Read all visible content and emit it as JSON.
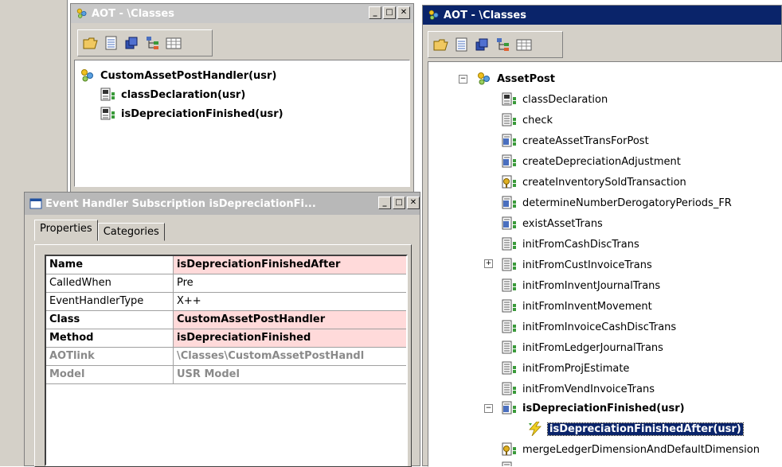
{
  "left_window": {
    "title": "AOT - \\Classes",
    "tree": [
      {
        "label": "CustomAssetPostHandler(usr)"
      },
      {
        "label": "classDeclaration(usr)"
      },
      {
        "label": "isDepreciationFinished(usr)"
      }
    ]
  },
  "event_dialog": {
    "title": "Event Handler Subscription isDepreciationFi...",
    "tabs": [
      {
        "label": "Properties"
      },
      {
        "label": "Categories"
      }
    ],
    "properties": [
      {
        "key": "Name",
        "value": "isDepreciationFinishedAfter"
      },
      {
        "key": "CalledWhen",
        "value": "Pre"
      },
      {
        "key": "EventHandlerType",
        "value": "X++"
      },
      {
        "key": "Class",
        "value": "CustomAssetPostHandler"
      },
      {
        "key": "Method",
        "value": "isDepreciationFinished"
      },
      {
        "key": "AOTlink",
        "value": "\\Classes\\CustomAssetPostHandl"
      },
      {
        "key": "Model",
        "value": "USR Model"
      }
    ]
  },
  "right_window": {
    "title": "AOT - \\Classes",
    "class_node": "AssetPost",
    "methods": [
      {
        "label": "classDeclaration"
      },
      {
        "label": "check"
      },
      {
        "label": "createAssetTransForPost"
      },
      {
        "label": "createDepreciationAdjustment"
      },
      {
        "label": "createInventorySoldTransaction"
      },
      {
        "label": "determineNumberDerogatoryPeriods_FR"
      },
      {
        "label": "existAssetTrans"
      },
      {
        "label": "initFromCashDiscTrans"
      },
      {
        "label": "initFromCustInvoiceTrans"
      },
      {
        "label": "initFromInventJournalTrans"
      },
      {
        "label": "initFromInventMovement"
      },
      {
        "label": "initFromInvoiceCashDiscTrans"
      },
      {
        "label": "initFromLedgerJournalTrans"
      },
      {
        "label": "initFromProjEstimate"
      },
      {
        "label": "initFromVendInvoiceTrans"
      },
      {
        "label": "isDepreciationFinished(usr)"
      },
      {
        "label": "isDepreciationFinishedAfter(usr)"
      },
      {
        "label": "mergeLedgerDimensionAndDefaultDimension"
      }
    ]
  },
  "icons": {
    "class": "class-node-icon",
    "method": "method-icon",
    "event": "event-handler-icon",
    "toolbar": [
      "open-folder-icon",
      "properties-icon",
      "compile-icon",
      "tree-icon",
      "grid-icon"
    ]
  },
  "colors": {
    "active_title": "#0a246a",
    "inactive_title": "#c8c8c8",
    "highlight_row": "#ffdada",
    "selection": "#0a246a"
  }
}
